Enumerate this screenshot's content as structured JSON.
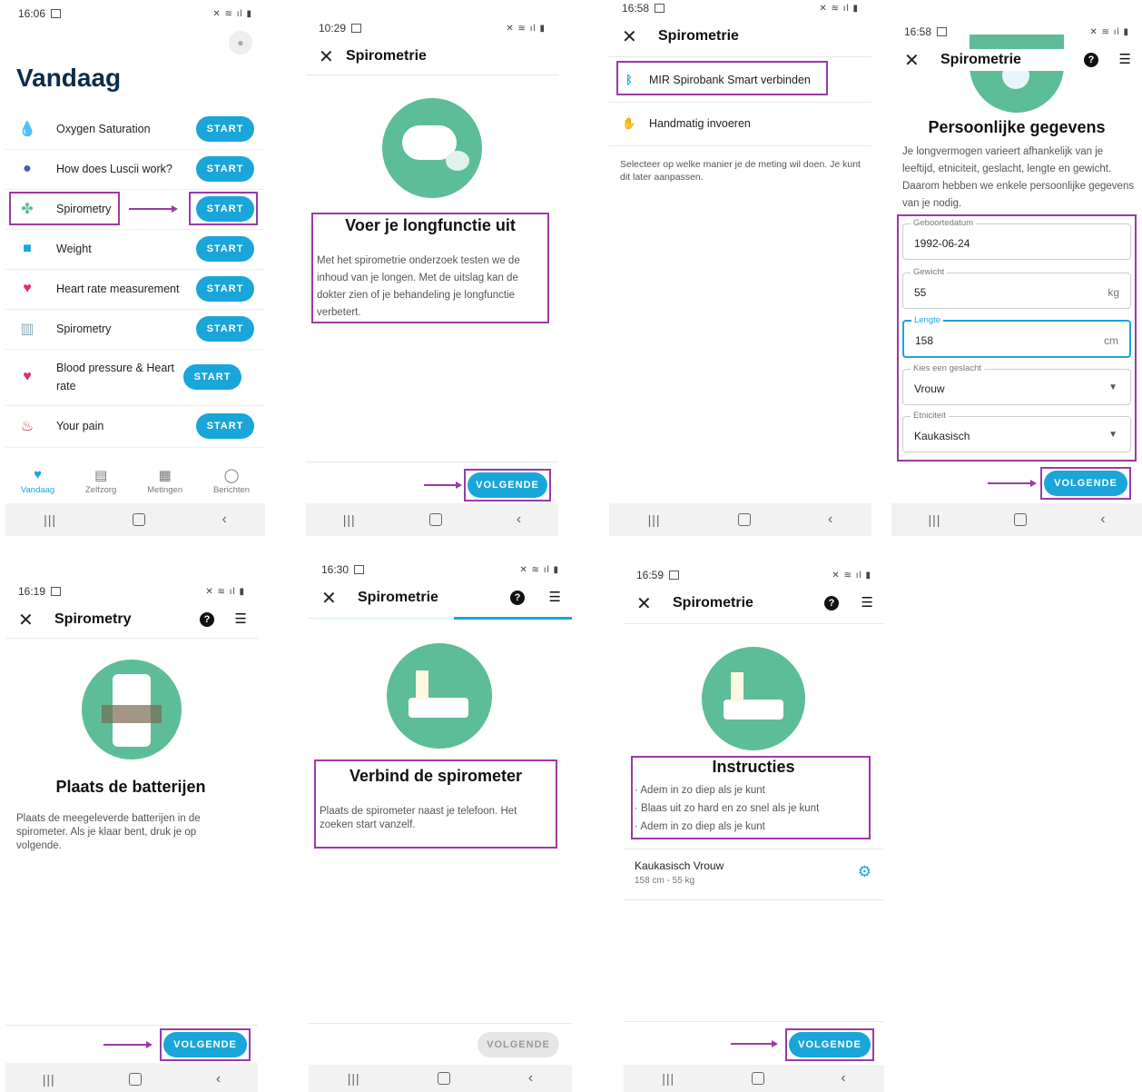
{
  "screen1": {
    "time": "16:06",
    "title": "Vandaag",
    "start_label": "START",
    "items": [
      {
        "label": "Oxygen Saturation",
        "icon": "oxygen-icon"
      },
      {
        "label": "How does Luscii work?",
        "icon": "lightbulb-icon"
      },
      {
        "label": "Spirometry",
        "icon": "spirometry-fan-icon"
      },
      {
        "label": "Weight",
        "icon": "scale-icon"
      },
      {
        "label": "Heart rate measurement",
        "icon": "heart-pulse-icon"
      },
      {
        "label": "Spirometry",
        "icon": "spirometry-bars-icon"
      },
      {
        "label": "Blood pressure & Heart rate",
        "icon": "blood-pressure-icon"
      },
      {
        "label": "Your pain",
        "icon": "flame-icon"
      }
    ],
    "tabs": [
      {
        "label": "Vandaag",
        "icon": "heart-tab-icon"
      },
      {
        "label": "Zelfzorg",
        "icon": "document-tab-icon"
      },
      {
        "label": "Metingen",
        "icon": "chart-tab-icon"
      },
      {
        "label": "Berichten",
        "icon": "chat-tab-icon"
      }
    ]
  },
  "screen2": {
    "time": "10:29",
    "header": "Spirometrie",
    "heading": "Voer je longfunctie uit",
    "body": "Met het spirometrie onderzoek testen we de inhoud van je longen. Met de uitslag kan de dokter zien of je behandeling je longfunctie verbetert.",
    "button": "VOLGENDE"
  },
  "screen3": {
    "time": "16:58",
    "header": "Spirometrie",
    "option1": "MIR Spirobank Smart verbinden",
    "option2": "Handmatig invoeren",
    "hint": "Selecteer op welke manier je de meting wil doen. Je kunt dit later aanpassen."
  },
  "screen4": {
    "time": "16:58",
    "header": "Spirometrie",
    "heading": "Persoonlijke gegevens",
    "body": "Je longvermogen varieert afhankelijk van je leeftijd, etniciteit, geslacht, lengte en gewicht. Daarom hebben we enkele persoonlijke gegevens van je nodig.",
    "fields": {
      "birth_label": "Geboortedatum",
      "birth_value": "1992-06-24",
      "weight_label": "Gewicht",
      "weight_value": "55",
      "weight_unit": "kg",
      "height_label": "Lengte",
      "height_value": "158",
      "height_unit": "cm",
      "gender_label": "Kies een geslacht",
      "gender_value": "Vrouw",
      "ethnicity_label": "Etniciteit",
      "ethnicity_value": "Kaukasisch"
    },
    "button": "VOLGENDE"
  },
  "screen5": {
    "time": "16:19",
    "header": "Spirometry",
    "heading": "Plaats de batterijen",
    "body": "Plaats de meegeleverde batterijen in de spirometer. Als je klaar bent, druk je op volgende.",
    "button": "VOLGENDE"
  },
  "screen6": {
    "time": "16:30",
    "header": "Spirometrie",
    "heading": "Verbind de spirometer",
    "body": "Plaats de spirometer naast je telefoon. Het zoeken start vanzelf.",
    "button": "VOLGENDE"
  },
  "screen7": {
    "time": "16:59",
    "header": "Spirometrie",
    "heading": "Instructies",
    "bullets": [
      "· Adem in zo diep als je kunt",
      "· Blaas uit zo hard en zo snel als je kunt",
      "· Adem in zo diep als je kunt"
    ],
    "profile_name": "Kaukasisch Vrouw",
    "profile_detail": "158 cm - 55 kg",
    "button": "VOLGENDE"
  },
  "colors": {
    "accent": "#1aa6d9",
    "annotation": "#9b3aa5",
    "illustration": "#5cbd98"
  }
}
